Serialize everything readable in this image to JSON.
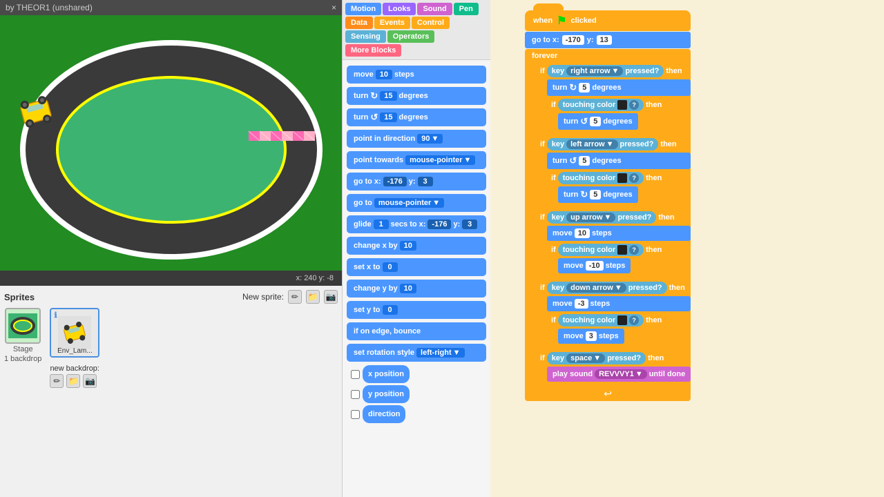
{
  "header": {
    "title": "by THEOR1 (unshared)",
    "close_btn": "×"
  },
  "stage": {
    "coords": "x: 240  y: -8"
  },
  "sprites": {
    "title": "Sprites",
    "new_sprite_label": "New sprite:",
    "stage_label": "Stage",
    "stage_sub": "1 backdrop",
    "backdrop_label": "new backdrop:",
    "sprite1_label": "Env_Lam...",
    "sprite_info_icon": "ℹ"
  },
  "categories": {
    "motion": "Motion",
    "looks": "Looks",
    "sound": "Sound",
    "pen": "Pen",
    "data": "Data",
    "events": "Events",
    "control": "Control",
    "sensing": "Sensing",
    "operators": "Operators",
    "more_blocks": "More Blocks"
  },
  "blocks": {
    "move_steps": "move",
    "move_val": "10",
    "move_unit": "steps",
    "turn_cw": "turn",
    "turn_cw_val": "15",
    "turn_cw_unit": "degrees",
    "turn_ccw": "turn",
    "turn_ccw_val": "15",
    "turn_ccw_unit": "degrees",
    "point_dir": "point in direction",
    "point_dir_val": "90",
    "point_towards": "point towards",
    "point_towards_val": "mouse-pointer",
    "go_to_x": "go to x:",
    "go_to_x_val": "-176",
    "go_to_y_val": "3",
    "go_to_mp": "go to",
    "go_to_mp_val": "mouse-pointer",
    "glide": "glide",
    "glide_secs": "1",
    "glide_to": "secs to x:",
    "glide_x": "-176",
    "glide_y": "3",
    "change_x": "change x by",
    "change_x_val": "10",
    "set_x": "set x to",
    "set_x_val": "0",
    "change_y": "change y by",
    "change_y_val": "10",
    "set_y": "set y to",
    "set_y_val": "0",
    "bounce": "if on edge, bounce",
    "rotation": "set rotation style",
    "rotation_val": "left-right",
    "x_pos": "x position",
    "y_pos": "y position",
    "direction": "direction"
  },
  "scripts": {
    "hat_label": "when",
    "flag_symbol": "⚑",
    "clicked_label": "clicked",
    "goto_label": "go to x:",
    "goto_x": "-170",
    "goto_y": "13",
    "forever_label": "forever",
    "if_label": "if",
    "then_label": "then",
    "key_right": "key",
    "right_arrow": "right arrow",
    "pressed": "pressed?",
    "turn_cw5": "turn",
    "cw5_val": "5",
    "cw5_unit": "degrees",
    "touching_color": "touching color",
    "color_swatch": "■",
    "question": "?",
    "turn_ccw5": "turn",
    "ccw5_val": "5",
    "ccw5_unit": "degrees",
    "key_left": "left arrow",
    "key_up": "up arrow",
    "key_down": "down arrow",
    "key_space": "space",
    "move10": "move",
    "move10_val": "10",
    "move_neg10": "move",
    "move_neg10_val": "-10",
    "move_neg3": "move",
    "move_neg3_val": "-3",
    "move3": "move",
    "move3_val": "3",
    "play_sound": "play sound",
    "sound_name": "REVVVY1",
    "until_done": "until done"
  }
}
